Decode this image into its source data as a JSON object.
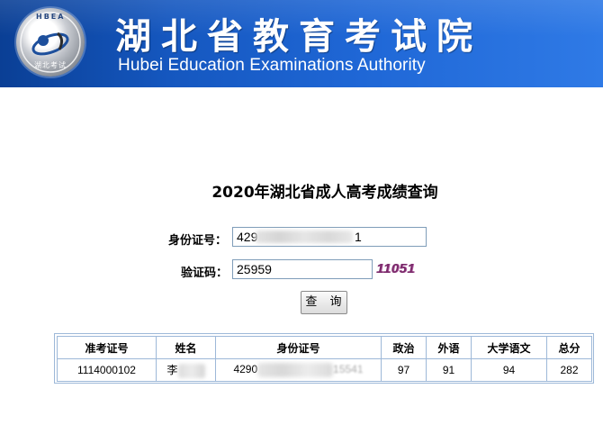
{
  "header": {
    "title_cn": "湖北省教育考试院",
    "title_en": "Hubei Education Examinations Authority",
    "logo_text_top": "HBEA",
    "logo_text_bottom": "湖北考试"
  },
  "page": {
    "heading": "2020年湖北省成人高考成绩查询"
  },
  "form": {
    "id_label": "身份证号：",
    "id_value_prefix": "429",
    "id_value_suffix": "1",
    "captcha_label": "验证码：",
    "captcha_value": "25959",
    "captcha_image_text": "11051",
    "query_button": "查 询"
  },
  "results": {
    "headers": [
      "准考证号",
      "姓名",
      "身份证号",
      "政治",
      "外语",
      "大学语文",
      "总分"
    ],
    "row": {
      "exam_no": "1114000102",
      "name": "李",
      "id_prefix": "4290",
      "id_suffix": "15541",
      "politics": "97",
      "foreign_language": "91",
      "college_chinese": "94",
      "total": "282"
    }
  },
  "colors": {
    "banner_dark": "#0a3f95",
    "banner_light": "#2f7ae6",
    "table_border": "#9db8d8",
    "captcha_text": "#7a2a6a"
  }
}
